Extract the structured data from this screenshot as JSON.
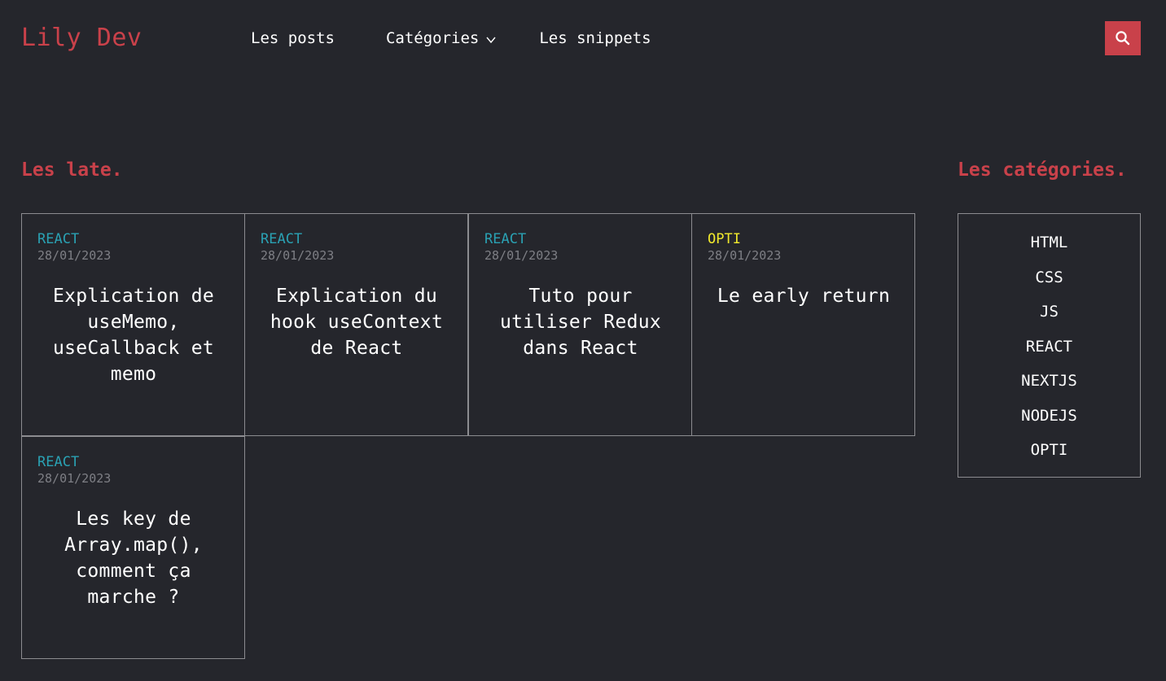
{
  "header": {
    "logo": "Lily Dev",
    "nav": {
      "posts": "Les posts",
      "categories": "Catégories",
      "snippets": "Les snippets"
    },
    "search_icon": "search-icon"
  },
  "latest": {
    "title": "Les late.",
    "posts": [
      {
        "category": "REACT",
        "category_color": "#2aa1b3",
        "date": "28/01/2023",
        "title": "Explication de useMemo, useCallback et memo"
      },
      {
        "category": "REACT",
        "category_color": "#2aa1b3",
        "date": "28/01/2023",
        "title": "Explication du hook useContext de React"
      },
      {
        "category": "REACT",
        "category_color": "#2aa1b3",
        "date": "28/01/2023",
        "title": "Tuto pour utiliser Redux dans React"
      },
      {
        "category": "OPTI",
        "category_color": "#f2ea2c",
        "date": "28/01/2023",
        "title": "Le early return"
      },
      {
        "category": "REACT",
        "category_color": "#2aa1b3",
        "date": "28/01/2023",
        "title": "Les key de Array.map(), comment ça marche ?"
      }
    ]
  },
  "categories": {
    "title": "Les catégories.",
    "items": [
      "HTML",
      "CSS",
      "JS",
      "REACT",
      "NEXTJS",
      "NODEJS",
      "OPTI"
    ]
  },
  "colors": {
    "accent": "#c9414a",
    "background": "#25262c",
    "react": "#2aa1b3",
    "opti": "#f2ea2c"
  }
}
